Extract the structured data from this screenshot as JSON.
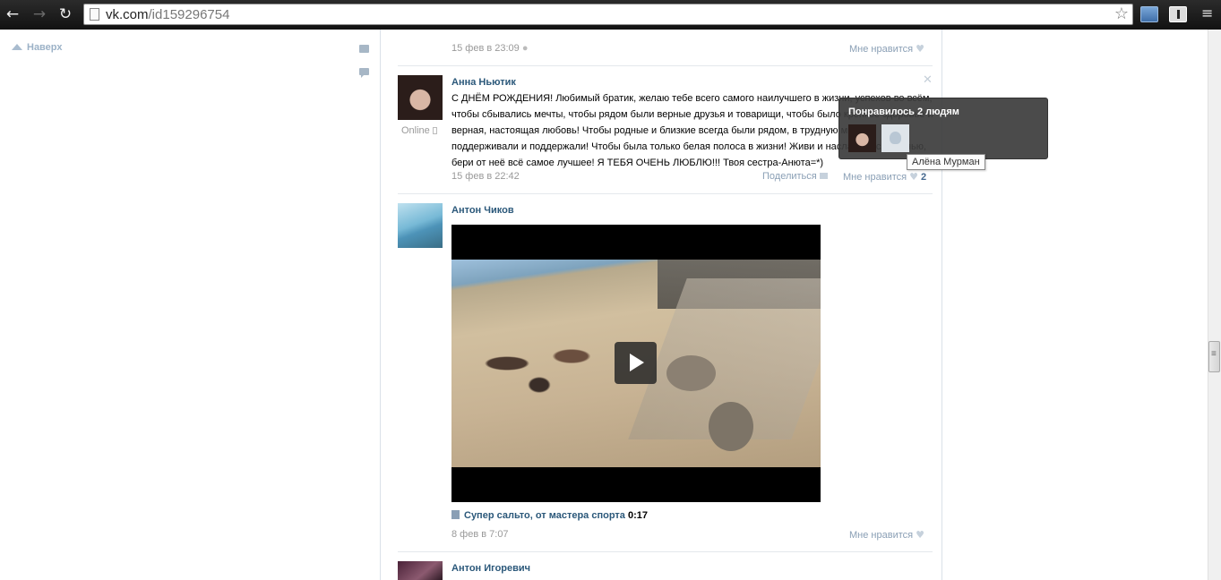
{
  "browser": {
    "url_domain": "vk.com",
    "url_path": "/id159296754"
  },
  "sidebar": {
    "to_top_label": "Наверх"
  },
  "posts": [
    {
      "date": "15 фев в 23:09",
      "like_label": "Мне нравится"
    },
    {
      "author": "Анна Ньютик",
      "online": "Online",
      "text": "С ДНЁМ РОЖДЕНИЯ! Любимый братик, желаю тебе всего самого наилучшего в жизни, успехов во всём, чтобы сбывались мечты, чтобы рядом были верные друзья и товарищи, чтобы было крепкое здоровье и верная, настоящая любовь! Чтобы родные и близкие всегда были рядом, в трудную минуту поддерживали и поддержали! Чтобы была только белая полоса в жизни! Живи и наслаждайся жизнью, бери от неё всё самое лучшее! Я ТЕБЯ ОЧЕНЬ ЛЮБЛЮ!!! Твоя сестра-Анюта=*)",
      "date": "15 фев в 22:42",
      "share_label": "Поделиться",
      "like_label": "Мне нравится",
      "like_count": "2"
    },
    {
      "author": "Антон Чиков",
      "video_title": "Супер сальто, от мастера спорта",
      "video_duration": "0:17",
      "date": "8 фев в 7:07",
      "like_label": "Мне нравится"
    },
    {
      "author": "Антон Игоревич"
    }
  ],
  "likes_popup": {
    "title": "Понравилось 2 людям",
    "tooltip_name": "Алёна Мурман"
  },
  "icons": {
    "back": "arrow-left-icon",
    "forward": "arrow-right-icon",
    "reload": "reload-icon",
    "star": "star-icon",
    "menu": "menu-icon"
  }
}
